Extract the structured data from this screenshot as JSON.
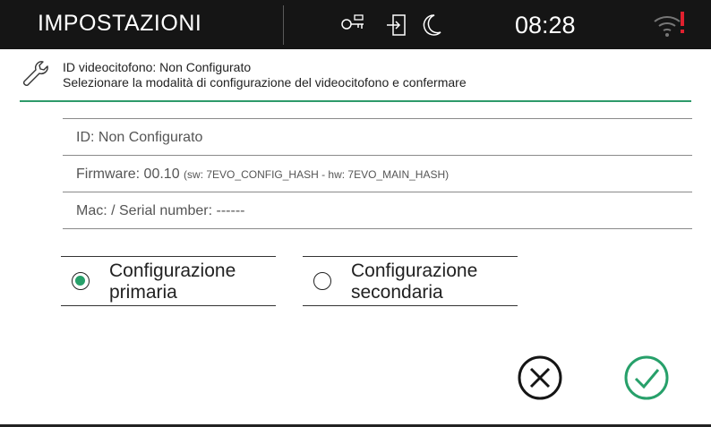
{
  "topbar": {
    "title": "IMPOSTAZIONI",
    "time": "08:28",
    "icons": [
      "key-icon",
      "door-exit-icon",
      "moon-icon",
      "wifi-alert-icon"
    ],
    "alert_color": "#e0202e"
  },
  "header": {
    "line1": "ID videocitofono: Non Configurato",
    "line2": "Selezionare la modalità di configurazione del videocitofono e confermare",
    "accent_color": "#2e9a6a"
  },
  "info": {
    "id": "ID: Non Configurato",
    "firmware": "Firmware: 00.10",
    "firmware_detail": "(sw: 7EVO_CONFIG_HASH - hw: 7EVO_MAIN_HASH)",
    "mac": "Mac:  / Serial number: ------"
  },
  "options": [
    {
      "line1": "Configurazione",
      "line2": "primaria",
      "selected": true
    },
    {
      "line1": "Configurazione",
      "line2": "secondaria",
      "selected": false
    }
  ],
  "actions": {
    "cancel_icon": "close-circle-icon",
    "confirm_icon": "check-circle-icon",
    "confirm_color": "#27a06a"
  }
}
